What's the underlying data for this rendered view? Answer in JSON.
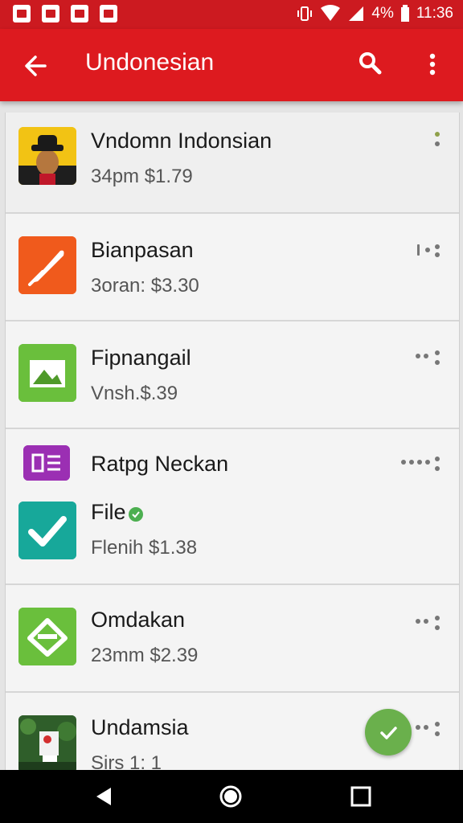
{
  "status_bar": {
    "battery": "4%",
    "time": "11:36"
  },
  "app_bar": {
    "title": "Undonesian",
    "back_icon": "arrow-back-icon",
    "search_icon": "search-icon",
    "overflow_icon": "more-vert-icon"
  },
  "colors": {
    "primary": "#dd1a1f",
    "status_bar": "#cc1a20",
    "fab": "#6ab04c"
  },
  "items": [
    {
      "title": "Vndomn Indonsian",
      "subtitle": "34pm $1.79",
      "icon": "person-avatar-icon"
    },
    {
      "title": "Bianpasan",
      "subtitle": "3oran: $3.30",
      "icon": "feather-icon"
    },
    {
      "title": "Fipnangail",
      "subtitle": "Vnsh.$.39",
      "icon": "image-icon"
    },
    {
      "title": "Ratpg Neckan",
      "subtitle": "",
      "icon": "newspaper-icon"
    },
    {
      "title": "File",
      "subtitle": "Flenih $1.38",
      "icon": "check-icon"
    },
    {
      "title": "Omdakan",
      "subtitle": "23mm $2.39",
      "icon": "diamond-icon"
    },
    {
      "title": "Undamsia",
      "subtitle": "Sirs 1: 1",
      "icon": "photo-thumbnail-icon"
    }
  ],
  "fab": {
    "icon": "check-icon"
  },
  "nav_bar": {
    "back": "nav-back-icon",
    "home": "nav-home-icon",
    "recents": "nav-recents-icon"
  }
}
